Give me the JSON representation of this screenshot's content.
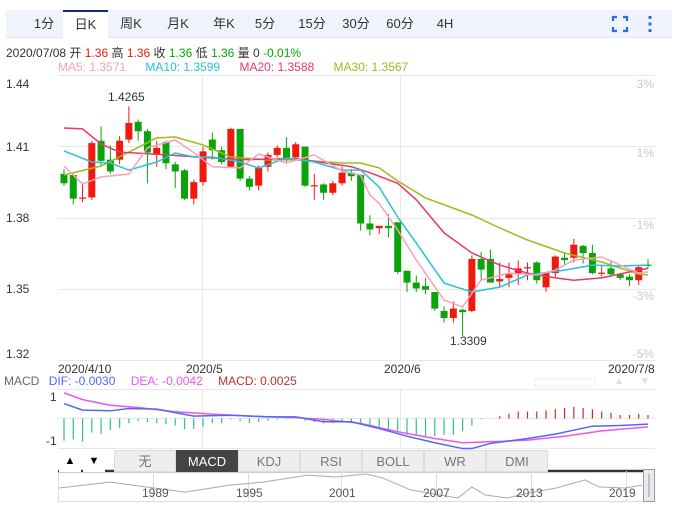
{
  "period_tabs": [
    "1分",
    "日K",
    "周K",
    "月K",
    "年K",
    "5分",
    "15分",
    "30分",
    "60分",
    "4H"
  ],
  "active_tab": "日K",
  "toolbar": {
    "fullscreen_icon": "fullscreen-icon",
    "more_icon": "more-vertical-icon"
  },
  "quote": {
    "date": "2020/07/08",
    "open_label": "开",
    "open": "1.36",
    "high_label": "高",
    "high": "1.36",
    "close_label": "收",
    "close": "1.36",
    "low_label": "低",
    "low": "1.36",
    "volume_label": "量",
    "volume": "0",
    "change": "-0.01%"
  },
  "ma_legend": {
    "ma5": "MA5: 1.3571",
    "ma10": "MA10: 1.3599",
    "ma20": "MA20: 1.3588",
    "ma30": "MA30: 1.3567"
  },
  "colors": {
    "up": "#f0190f",
    "down": "#0aa30a",
    "ma5": "#f7a1ba",
    "ma10": "#29c0dc",
    "ma20": "#e8386d",
    "ma30": "#9bbd1e",
    "dif": "#5068f2",
    "dea": "#ee55ee",
    "macd_text": "#c0302a",
    "tab_active": "#0f2a7a"
  },
  "chart_data": [
    {
      "type": "candlestick",
      "title": "日K",
      "y_ticks": [
        "1.44",
        "1.41",
        "1.38",
        "1.35",
        "1.32"
      ],
      "pct_ticks": [
        "3%",
        "1%",
        "-1%",
        "-3%",
        "-5%"
      ],
      "x_ticks": [
        "2020/4/10",
        "2020/5",
        "2020/6",
        "2020/7/8"
      ],
      "annotations": {
        "max": "1.4265",
        "min": "1.3309"
      },
      "ylim": [
        1.32,
        1.44
      ],
      "ohlc": [
        [
          1.402,
          1.404,
          1.397,
          1.398
        ],
        [
          1.4015,
          1.402,
          1.389,
          1.3915
        ],
        [
          1.3915,
          1.3975,
          1.39,
          1.392
        ],
        [
          1.392,
          1.416,
          1.391,
          1.415
        ],
        [
          1.416,
          1.422,
          1.405,
          1.4075
        ],
        [
          1.408,
          1.414,
          1.402,
          1.403
        ],
        [
          1.408,
          1.418,
          1.406,
          1.416
        ],
        [
          1.4165,
          1.4305,
          1.415,
          1.4235
        ],
        [
          1.424,
          1.425,
          1.416,
          1.42
        ],
        [
          1.42,
          1.421,
          1.398,
          1.411
        ],
        [
          1.41,
          1.416,
          1.405,
          1.413
        ],
        [
          1.4155,
          1.416,
          1.404,
          1.4065
        ],
        [
          1.406,
          1.407,
          1.396,
          1.403
        ],
        [
          1.4035,
          1.404,
          1.391,
          1.3915
        ],
        [
          1.3915,
          1.3995,
          1.389,
          1.3985
        ],
        [
          1.3985,
          1.4135,
          1.397,
          1.4115
        ],
        [
          1.4165,
          1.4195,
          1.408,
          1.412
        ],
        [
          1.412,
          1.4135,
          1.406,
          1.407
        ],
        [
          1.405,
          1.4215,
          1.4045,
          1.421
        ],
        [
          1.421,
          1.421,
          1.399,
          1.4
        ],
        [
          1.4,
          1.401,
          1.395,
          1.3965
        ],
        [
          1.397,
          1.4055,
          1.395,
          1.4045
        ],
        [
          1.405,
          1.411,
          1.403,
          1.41
        ],
        [
          1.41,
          1.414,
          1.409,
          1.413
        ],
        [
          1.413,
          1.4175,
          1.407,
          1.408
        ],
        [
          1.409,
          1.4155,
          1.4075,
          1.4145
        ],
        [
          1.4135,
          1.4135,
          1.3965,
          1.397
        ],
        [
          1.397,
          1.402,
          1.391,
          1.3972
        ],
        [
          1.3975,
          1.398,
          1.391,
          1.394
        ],
        [
          1.394,
          1.399,
          1.393,
          1.398
        ],
        [
          1.398,
          1.405,
          1.397,
          1.4025
        ],
        [
          1.4025,
          1.404,
          1.399,
          1.401
        ],
        [
          1.4015,
          1.402,
          1.378,
          1.381
        ],
        [
          1.381,
          1.3845,
          1.376,
          1.3785
        ],
        [
          1.379,
          1.38,
          1.3765,
          1.38
        ],
        [
          1.38,
          1.385,
          1.375,
          1.379
        ],
        [
          1.3815,
          1.3815,
          1.3595,
          1.3605
        ],
        [
          1.361,
          1.361,
          1.352,
          1.356
        ],
        [
          1.356,
          1.359,
          1.352,
          1.3535
        ],
        [
          1.3545,
          1.358,
          1.351,
          1.353
        ],
        [
          1.352,
          1.352,
          1.344,
          1.345
        ],
        [
          1.344,
          1.346,
          1.339,
          1.341
        ],
        [
          1.341,
          1.348,
          1.339,
          1.345
        ],
        [
          1.3445,
          1.345,
          1.3335,
          1.3435
        ],
        [
          1.344,
          1.3675,
          1.3435,
          1.366
        ],
        [
          1.366,
          1.369,
          1.357,
          1.3615
        ],
        [
          1.366,
          1.37,
          1.3565,
          1.356
        ],
        [
          1.3565,
          1.3645,
          1.354,
          1.3575
        ],
        [
          1.358,
          1.3645,
          1.354,
          1.3595
        ],
        [
          1.3595,
          1.3655,
          1.355,
          1.362
        ],
        [
          1.362,
          1.3645,
          1.357,
          1.3625
        ],
        [
          1.3645,
          1.365,
          1.3555,
          1.357
        ],
        [
          1.354,
          1.36,
          1.352,
          1.36
        ],
        [
          1.36,
          1.3675,
          1.358,
          1.367
        ],
        [
          1.3665,
          1.3685,
          1.3635,
          1.3655
        ],
        [
          1.3665,
          1.3745,
          1.3645,
          1.372
        ],
        [
          1.3715,
          1.372,
          1.364,
          1.3685
        ],
        [
          1.3685,
          1.372,
          1.3595,
          1.36
        ],
        [
          1.3598,
          1.363,
          1.3585,
          1.3602
        ],
        [
          1.362,
          1.3655,
          1.3585,
          1.3595
        ],
        [
          1.3595,
          1.36,
          1.357,
          1.358
        ],
        [
          1.3585,
          1.3595,
          1.3545,
          1.357
        ],
        [
          1.357,
          1.363,
          1.355,
          1.3625
        ],
        [
          1.3636,
          1.366,
          1.362,
          1.3634
        ]
      ],
      "ma": {
        "ma5": [
          [
            0,
            1.4053
          ],
          [
            2,
            1.3977
          ],
          [
            4,
            1.4007
          ],
          [
            7,
            1.4019
          ],
          [
            9,
            1.413
          ],
          [
            12,
            1.4163
          ],
          [
            14,
            1.411
          ],
          [
            16,
            1.405
          ],
          [
            19,
            1.4045
          ],
          [
            21,
            1.4104
          ],
          [
            24,
            1.4066
          ],
          [
            27,
            1.41
          ],
          [
            30,
            1.4032
          ],
          [
            32,
            1.4015
          ],
          [
            33,
            1.393
          ],
          [
            34,
            1.3895
          ],
          [
            36,
            1.3782
          ],
          [
            38,
            1.3655
          ],
          [
            41,
            1.3486
          ],
          [
            43,
            1.3457
          ],
          [
            45,
            1.3571
          ],
          [
            48,
            1.36
          ],
          [
            51,
            1.3592
          ],
          [
            53,
            1.3613
          ],
          [
            55,
            1.3655
          ],
          [
            58,
            1.3668
          ],
          [
            60,
            1.3634
          ],
          [
            62,
            1.36
          ],
          [
            63,
            1.3605
          ]
        ],
        "ma10": [
          [
            0,
            1.4117
          ],
          [
            3,
            1.407
          ],
          [
            5,
            1.4066
          ],
          [
            7,
            1.4036
          ],
          [
            10,
            1.407
          ],
          [
            12,
            1.4108
          ],
          [
            14,
            1.4091
          ],
          [
            16,
            1.4091
          ],
          [
            19,
            1.407
          ],
          [
            21,
            1.4045
          ],
          [
            24,
            1.4087
          ],
          [
            27,
            1.407
          ],
          [
            30,
            1.4036
          ],
          [
            32,
            1.4036
          ],
          [
            34,
            1.3964
          ],
          [
            36,
            1.3837
          ],
          [
            38,
            1.3727
          ],
          [
            41,
            1.3558
          ],
          [
            44,
            1.352
          ],
          [
            47,
            1.3541
          ],
          [
            50,
            1.3592
          ],
          [
            54,
            1.3613
          ],
          [
            57,
            1.3634
          ],
          [
            60,
            1.363
          ],
          [
            63,
            1.3634
          ]
        ],
        "ma20": [
          [
            0,
            1.4214
          ],
          [
            2,
            1.421
          ],
          [
            4,
            1.4146
          ],
          [
            6,
            1.4112
          ],
          [
            11,
            1.41
          ],
          [
            19,
            1.408
          ],
          [
            25,
            1.4085
          ],
          [
            31,
            1.405
          ],
          [
            33,
            1.4025
          ],
          [
            36,
            1.398
          ],
          [
            38,
            1.391
          ],
          [
            41,
            1.377
          ],
          [
            44,
            1.3685
          ],
          [
            47,
            1.3634
          ],
          [
            50,
            1.36
          ],
          [
            53,
            1.358
          ],
          [
            55,
            1.357
          ],
          [
            58,
            1.358
          ],
          [
            62,
            1.3613
          ],
          [
            63,
            1.362
          ]
        ],
        "ma30": [
          [
            0,
            1.4015
          ],
          [
            4,
            1.4053
          ],
          [
            7,
            1.4112
          ],
          [
            10,
            1.4172
          ],
          [
            12,
            1.4176
          ],
          [
            15,
            1.4142
          ],
          [
            18,
            1.4091
          ],
          [
            22,
            1.4079
          ],
          [
            25,
            1.4079
          ],
          [
            30,
            1.4066
          ],
          [
            32,
            1.4066
          ],
          [
            34,
            1.4045
          ],
          [
            36,
            1.399
          ],
          [
            39,
            1.3918
          ],
          [
            44,
            1.3846
          ],
          [
            47,
            1.3791
          ],
          [
            50,
            1.374
          ],
          [
            54,
            1.3685
          ],
          [
            58,
            1.3647
          ],
          [
            62,
            1.3596
          ],
          [
            63,
            1.3592
          ]
        ]
      }
    },
    {
      "type": "bar+line",
      "title": "MACD",
      "y_ticks": [
        "1",
        "-1"
      ],
      "ylim": [
        -1.3,
        1.25
      ],
      "histogram": [
        -0.95,
        -0.9,
        -1.0,
        -0.6,
        -0.65,
        -0.5,
        -0.4,
        -0.2,
        -0.1,
        -0.15,
        -0.2,
        -0.25,
        -0.3,
        -0.45,
        -0.45,
        -0.35,
        -0.2,
        -0.2,
        -0.05,
        -0.1,
        -0.2,
        -0.15,
        -0.1,
        -0.05,
        -0.03,
        0,
        -0.1,
        -0.15,
        -0.2,
        -0.2,
        -0.15,
        -0.15,
        -0.2,
        -0.35,
        -0.4,
        -0.45,
        -0.55,
        -0.7,
        -0.75,
        -0.8,
        -0.75,
        -0.7,
        -0.7,
        -0.55,
        -0.3,
        -0.03,
        0,
        0.1,
        0.2,
        0.3,
        0.3,
        0.3,
        0.35,
        0.4,
        0.45,
        0.5,
        0.45,
        0.4,
        0.3,
        0.25,
        0.15,
        0.15,
        0.2,
        0.15
      ],
      "dif": [
        [
          0,
          0.64
        ],
        [
          2,
          0.36
        ],
        [
          5,
          0.33
        ],
        [
          7,
          0.43
        ],
        [
          10,
          0.4
        ],
        [
          14,
          0.1
        ],
        [
          18,
          0.14
        ],
        [
          22,
          0.07
        ],
        [
          25,
          0.07
        ],
        [
          28,
          -0.14
        ],
        [
          31,
          -0.14
        ],
        [
          34,
          -0.43
        ],
        [
          37,
          -0.76
        ],
        [
          40,
          -1.04
        ],
        [
          43,
          -1.29
        ],
        [
          44,
          -1.29
        ],
        [
          46,
          -1.07
        ],
        [
          50,
          -0.86
        ],
        [
          53,
          -0.67
        ],
        [
          57,
          -0.33
        ],
        [
          60,
          -0.3
        ],
        [
          63,
          -0.24
        ]
      ],
      "dea": [
        [
          0,
          1.1
        ],
        [
          2,
          0.81
        ],
        [
          5,
          0.57
        ],
        [
          8,
          0.47
        ],
        [
          12,
          0.29
        ],
        [
          16,
          0.19
        ],
        [
          20,
          0.1
        ],
        [
          25,
          0.04
        ],
        [
          28,
          -0.04
        ],
        [
          32,
          -0.21
        ],
        [
          36,
          -0.57
        ],
        [
          40,
          -0.86
        ],
        [
          43,
          -1.04
        ],
        [
          46,
          -1.0
        ],
        [
          50,
          -0.93
        ],
        [
          54,
          -0.76
        ],
        [
          58,
          -0.53
        ],
        [
          63,
          -0.36
        ]
      ],
      "legend": {
        "name": "MACD",
        "dif": "DIF: -0.0030",
        "dea": "DEA: -0.0042",
        "macd": "MACD: 0.0025"
      }
    },
    {
      "type": "line",
      "title": "history-navigator",
      "x_ticks": [
        "1989",
        "1995",
        "2001",
        "2007",
        "2013",
        "2019"
      ],
      "points": [
        [
          1982.7,
          1.22
        ],
        [
          1986,
          1.38
        ],
        [
          1988.3,
          1.25
        ],
        [
          1990.9,
          1.11
        ],
        [
          1993.8,
          1.3
        ],
        [
          1996,
          1.38
        ],
        [
          1998.9,
          1.57
        ],
        [
          2000.7,
          1.52
        ],
        [
          2002.7,
          1.6
        ],
        [
          2003.8,
          1.49
        ],
        [
          2005.6,
          1.17
        ],
        [
          2007.5,
          1.03
        ],
        [
          2008.7,
          0.95
        ],
        [
          2009.6,
          1.25
        ],
        [
          2010.5,
          1.03
        ],
        [
          2011.9,
          0.95
        ],
        [
          2013.4,
          1.09
        ],
        [
          2015.1,
          1.22
        ],
        [
          2017,
          1.44
        ],
        [
          2017.9,
          1.25
        ],
        [
          2019.6,
          1.22
        ],
        [
          2021.2,
          1.3
        ]
      ]
    }
  ],
  "indicator_tabs": [
    "无",
    "MACD",
    "KDJ",
    "RSI",
    "BOLL",
    "WR",
    "DMI"
  ],
  "active_indicator": "MACD",
  "arrows": {
    "up": "▲",
    "down": "▼"
  }
}
